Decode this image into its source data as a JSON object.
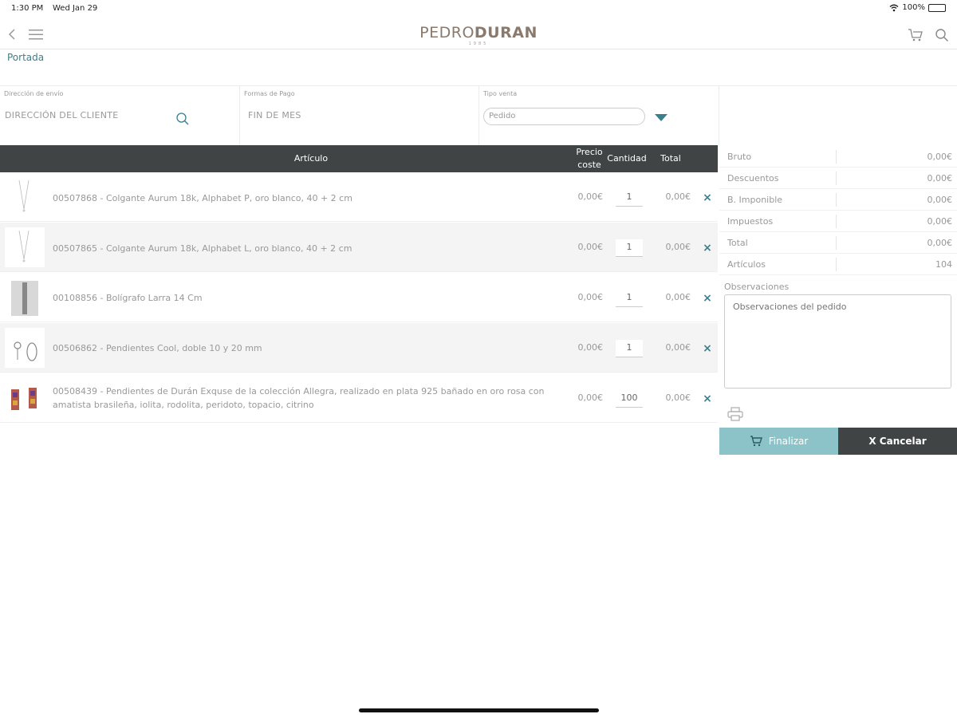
{
  "status_bar": {
    "time": "1:30 PM",
    "date": "Wed Jan 29",
    "battery": "100%"
  },
  "header": {
    "logo_part1": "PEDRO",
    "logo_part2": "DURAN",
    "logo_sub": "1985"
  },
  "breadcrumb": "Portada",
  "form": {
    "address_label": "Dirección de envío",
    "address_value": "DIRECCIÓN DEL CLIENTE",
    "payment_label": "Formas de Pago",
    "payment_value": "FIN DE MES",
    "sale_type_label": "Tipo venta",
    "sale_type_value": "Pedido"
  },
  "table": {
    "headers": {
      "article": "Artículo",
      "price": "Precio coste",
      "quantity": "Cantidad",
      "total": "Total"
    },
    "rows": [
      {
        "desc": "00507868 - Colgante Aurum 18k, Alphabet P, oro blanco, 40 + 2 cm",
        "price": "0,00€",
        "qty": "1",
        "total": "0,00€",
        "remove": "×"
      },
      {
        "desc": "00507865 - Colgante Aurum 18k, Alphabet L, oro blanco, 40 + 2 cm",
        "price": "0,00€",
        "qty": "1",
        "total": "0,00€",
        "remove": "×"
      },
      {
        "desc": "00108856 - Bolígrafo Larra 14 Cm",
        "price": "0,00€",
        "qty": "1",
        "total": "0,00€",
        "remove": "×"
      },
      {
        "desc": "00506862 - Pendientes Cool, doble 10 y 20 mm",
        "price": "0,00€",
        "qty": "1",
        "total": "0,00€",
        "remove": "×"
      },
      {
        "desc": "00508439 - Pendientes de Durán Exquse de la colección Allegra, realizado en plata 925 bañado en oro rosa con amatista brasileña, iolita, rodolita, peridoto, topacio, citrino",
        "price": "0,00€",
        "qty": "100",
        "total": "0,00€",
        "remove": "×"
      }
    ]
  },
  "summary": {
    "rows": [
      {
        "label": "Bruto",
        "value": "0,00€"
      },
      {
        "label": "Descuentos",
        "value": "0,00€"
      },
      {
        "label": "B. Imponible",
        "value": "0,00€"
      },
      {
        "label": "Impuestos",
        "value": "0,00€"
      },
      {
        "label": "Total",
        "value": "0,00€"
      },
      {
        "label": "Artículos",
        "value": "104"
      }
    ],
    "observations_label": "Observaciones",
    "observations_placeholder": "Observaciones del pedido"
  },
  "buttons": {
    "finish": "Finalizar",
    "cancel": "X Cancelar"
  },
  "colors": {
    "accent": "#3c7f8c",
    "header_dark": "#404444",
    "finish_bg": "#8cc3c8"
  }
}
